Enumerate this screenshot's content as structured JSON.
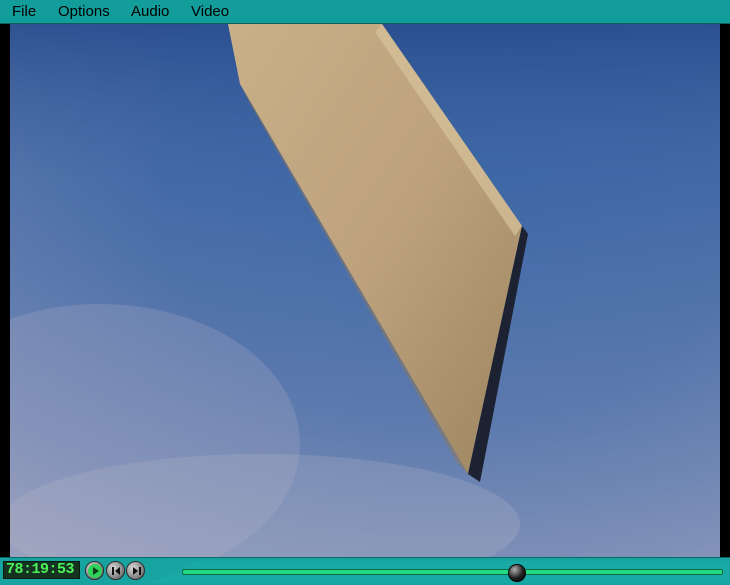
{
  "menubar": {
    "items": [
      {
        "label": "File"
      },
      {
        "label": "Options"
      },
      {
        "label": "Audio"
      },
      {
        "label": "Video"
      }
    ]
  },
  "video": {
    "icon": "video-frame-blade-against-sky"
  },
  "controls": {
    "timecode": "78:19:53",
    "play_icon": "play-icon",
    "step_back_icon": "step-back-icon",
    "step_forward_icon": "step-forward-icon",
    "seek_position": 0.62
  },
  "colors": {
    "menubar": "#129c9a",
    "seek_track": "#1fdc84",
    "timecode_text": "#4cf25a"
  }
}
